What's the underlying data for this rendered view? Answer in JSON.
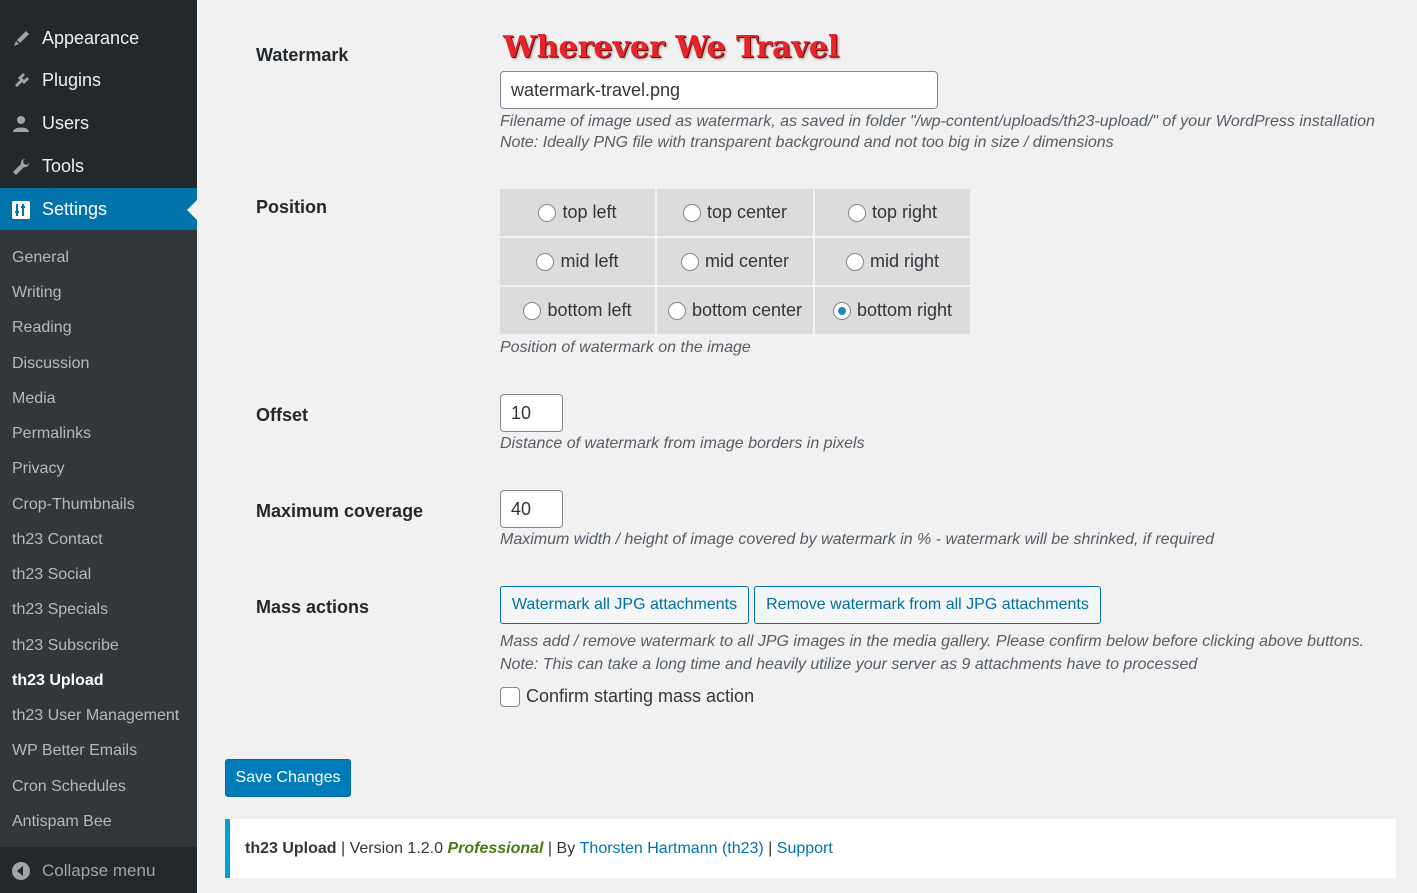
{
  "sidebar": {
    "menu": [
      {
        "label": "Appearance",
        "icon": "paintbrush-icon"
      },
      {
        "label": "Plugins",
        "icon": "plugin-icon"
      },
      {
        "label": "Users",
        "icon": "user-icon"
      },
      {
        "label": "Tools",
        "icon": "wrench-icon"
      },
      {
        "label": "Settings",
        "icon": "settings-icon",
        "current": true
      }
    ],
    "submenu": [
      "General",
      "Writing",
      "Reading",
      "Discussion",
      "Media",
      "Permalinks",
      "Privacy",
      "Crop-Thumbnails",
      "th23 Contact",
      "th23 Social",
      "th23 Specials",
      "th23 Subscribe",
      "th23 Upload",
      "th23 User Management",
      "WP Better Emails",
      "Cron Schedules",
      "Antispam Bee"
    ],
    "active_submenu": "th23 Upload",
    "collapse_label": "Collapse menu"
  },
  "watermark": {
    "label": "Watermark",
    "logo_text": "Wherever We Travel",
    "value": "watermark-travel.png",
    "desc1": "Filename of image used as watermark, as saved in folder \"/wp-content/uploads/th23-upload/\" of your WordPress installation",
    "desc2": "Note: Ideally PNG file with transparent background and not too big in size / dimensions"
  },
  "position": {
    "label": "Position",
    "options": [
      "top left",
      "top center",
      "top right",
      "mid left",
      "mid center",
      "mid right",
      "bottom left",
      "bottom center",
      "bottom right"
    ],
    "selected": "bottom right",
    "desc": "Position of watermark on the image"
  },
  "offset": {
    "label": "Offset",
    "value": "10",
    "desc": "Distance of watermark from image borders in pixels"
  },
  "coverage": {
    "label": "Maximum coverage",
    "value": "40",
    "desc": "Maximum width / height of image covered by watermark in % - watermark will be shrinked, if required"
  },
  "mass": {
    "label": "Mass actions",
    "btn_add": "Watermark all JPG attachments",
    "btn_remove": "Remove watermark from all JPG attachments",
    "desc1": "Mass add / remove watermark to all JPG images in the media gallery. Please confirm below before clicking above buttons.",
    "desc2": "Note: This can take a long time and heavily utilize your server as 9 attachments have to processed",
    "confirm_label": "Confirm starting mass action"
  },
  "save_label": "Save Changes",
  "footer": {
    "plugin": "th23 Upload",
    "sep1": " | Version 1.2.0 ",
    "edition": "Professional",
    "sep2": " | By ",
    "author": "Thorsten Hartmann (th23)",
    "sep3": " | ",
    "support": "Support"
  },
  "colors": {
    "accent": "#0073aa",
    "sidebar": "#23282d",
    "submenu": "#32373c",
    "logo": "#e8242b"
  }
}
